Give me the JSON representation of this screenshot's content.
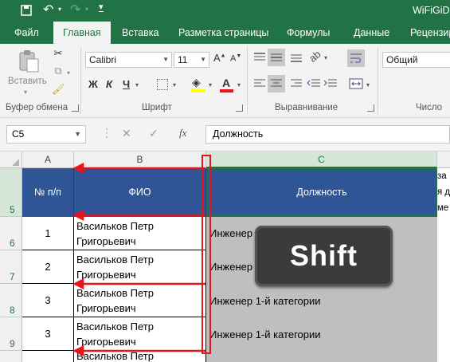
{
  "title_bar": {
    "app_title": "WiFiGiD"
  },
  "tabs": [
    {
      "label": "Файл",
      "active": false
    },
    {
      "label": "Главная",
      "active": true
    },
    {
      "label": "Вставка",
      "active": false
    },
    {
      "label": "Разметка страницы",
      "active": false
    },
    {
      "label": "Формулы",
      "active": false
    },
    {
      "label": "Данные",
      "active": false
    },
    {
      "label": "Рецензир",
      "active": false
    }
  ],
  "ribbon": {
    "paste_label": "Вставить",
    "clipboard_group": "Буфер обмена",
    "font_name": "Calibri",
    "font_size": "11",
    "font_group": "Шрифт",
    "bold": "Ж",
    "italic": "К",
    "underline": "Ч",
    "font_color_letter": "А",
    "alignment_group": "Выравнивание",
    "number_format": "Общий",
    "number_group": "Число"
  },
  "formula_bar": {
    "name_box": "C5",
    "fx": "fx",
    "content": "Должность"
  },
  "columns": [
    "A",
    "B",
    "C"
  ],
  "rows": [
    {
      "num": "5",
      "a": "№ п/п",
      "b": "ФИО",
      "c": "Должность"
    },
    {
      "num": "6",
      "a": "1",
      "b": "Васильков Петр Григорьевич",
      "c": "Инженер"
    },
    {
      "num": "7",
      "a": "2",
      "b": "Васильков Петр Григорьевич",
      "c": "Инженер"
    },
    {
      "num": "8",
      "a": "3",
      "b": "Васильков Петр Григорьевич",
      "c": "Инженер 1-й категории"
    },
    {
      "num": "9",
      "a": "3",
      "b": "Васильков Петр Григорьевич",
      "c": "Инженер 1-й категории"
    },
    {
      "num": "",
      "a": "",
      "b": "Васильков Петр",
      "c": ""
    }
  ],
  "partial_column_text": [
    "за",
    "я д",
    "ме"
  ],
  "overlay": {
    "key_label": "Shift"
  },
  "colors": {
    "excel_green": "#217346",
    "header_blue": "#2f5597",
    "annotation_red": "#e8141c",
    "selection_gray": "#bfbfbf"
  }
}
